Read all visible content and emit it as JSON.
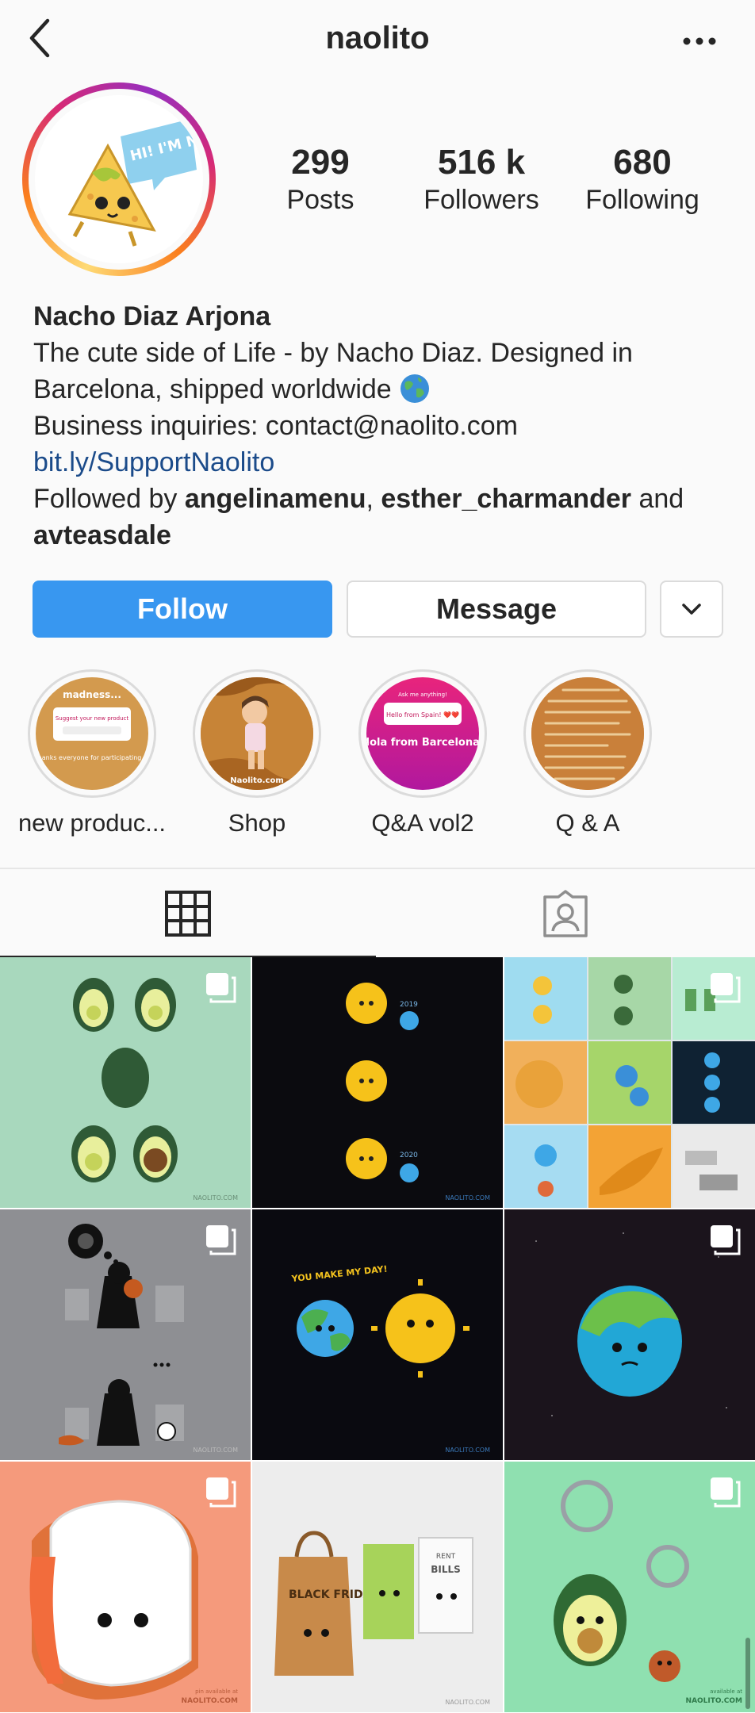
{
  "header": {
    "username": "naolito"
  },
  "stats": [
    {
      "value": "299",
      "label": "Posts"
    },
    {
      "value": "516 k",
      "label": "Followers"
    },
    {
      "value": "680",
      "label": "Following"
    }
  ],
  "avatar": {
    "speech_bubble": "HI! I'M NACHO"
  },
  "bio": {
    "name": "Nacho Diaz Arjona",
    "line1": "The cute side of Life - by Nacho Diaz. Designed in",
    "line2": "Barcelona, shipped worldwide",
    "line3": "Business inquiries: contact@naolito.com",
    "link": "bit.ly/SupportNaolito",
    "followed_prefix": "Followed by",
    "followed_user1": "angelinamenu",
    "followed_sep": ",",
    "followed_user2": "esther_charmander",
    "followed_and": "and",
    "followed_user3": "avteasdale"
  },
  "actions": {
    "follow": "Follow",
    "message": "Message"
  },
  "highlights": [
    {
      "label": "new produc...",
      "thumb_top": "madness...",
      "thumb_card": "Suggest your new product",
      "thumb_bottom": "Thanks everyone for participating 😉"
    },
    {
      "label": "Shop",
      "thumb_caption": "Naolito.com"
    },
    {
      "label": "Q&A vol2",
      "thumb_top": "Ask me anything!",
      "thumb_card": "Hello from Spain! ❤️❤️",
      "thumb_bottom": "Hola from Barcelona!"
    },
    {
      "label": "Q & A"
    }
  ],
  "posts": [
    {
      "subject": "avocado couple",
      "caption": "NAOLITO.COM",
      "bg": "#a8d8bd",
      "multi": true
    },
    {
      "subject": "sun and earth 2019 2020",
      "caption": "NAOLITO.COM",
      "bg": "#0b0b0f",
      "year_top": "2019",
      "year_bottom": "2020",
      "multi": false
    },
    {
      "subject": "collage",
      "bg": "#dfe6e9",
      "multi": true
    },
    {
      "subject": "vader balloon",
      "caption": "NAOLITO.COM",
      "bg": "#8e8f93",
      "multi": true
    },
    {
      "subject": "you make my day",
      "caption": "NAOLITO.COM",
      "bg": "#0a0a10",
      "text": "YOU MAKE MY DAY!",
      "multi": false
    },
    {
      "subject": "sad earth",
      "bg": "#1b141c",
      "multi": true
    },
    {
      "subject": "sushi pin",
      "caption_top": "pin available at",
      "caption": "NAOLITO.COM",
      "bg": "#f59a7c",
      "multi": true
    },
    {
      "subject": "black friday",
      "caption": "NAOLITO.COM",
      "bg": "#ededed",
      "bag_text": "BLACK FRIDAY",
      "bills_text": "BILLS",
      "rent_text": "RENT",
      "multi": false
    },
    {
      "subject": "avocado keychain",
      "caption_top": "available at",
      "caption": "NAOLITO.COM",
      "bg": "#8fe0b0",
      "multi": true
    }
  ]
}
